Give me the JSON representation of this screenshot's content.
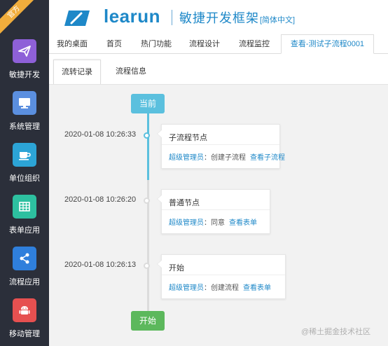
{
  "sidebar": {
    "ribbon": "官方",
    "items": [
      {
        "label": "敏捷开发",
        "icon": "paper-plane-icon",
        "color": "#8e60d8"
      },
      {
        "label": "系统管理",
        "icon": "monitor-icon",
        "color": "#5b8fdf"
      },
      {
        "label": "单位组织",
        "icon": "coffee-cup-icon",
        "color": "#2ca4d6"
      },
      {
        "label": "表单应用",
        "icon": "table-grid-icon",
        "color": "#2dc0a0"
      },
      {
        "label": "流程应用",
        "icon": "share-icon",
        "color": "#2f7fdc"
      },
      {
        "label": "移动管理",
        "icon": "android-icon",
        "color": "#e65050"
      }
    ]
  },
  "header": {
    "logo_text": "learun",
    "subtitle": "敏捷开发框架",
    "lang": "[简体中文]"
  },
  "top_tabs": [
    {
      "label": "我的桌面"
    },
    {
      "label": "首页"
    },
    {
      "label": "热门功能"
    },
    {
      "label": "流程设计"
    },
    {
      "label": "流程监控"
    },
    {
      "label": "查看-测试子流程0001",
      "active": true
    }
  ],
  "sub_tabs": [
    {
      "label": "流转记录",
      "active": true
    },
    {
      "label": "流程信息"
    }
  ],
  "timeline": {
    "top_badge": "当前",
    "bottom_badge": "开始",
    "colors": {
      "current": "#5bc0de",
      "start": "#5cb85c",
      "link": "#1e88c8"
    },
    "entries": [
      {
        "time": "2020-01-08 10:26:33",
        "title": "子流程节点",
        "user": "超级管理员",
        "action": "创建子流程",
        "link": "查看子流程"
      },
      {
        "time": "2020-01-08 10:26:20",
        "title": "普通节点",
        "user": "超级管理员",
        "action": "同意",
        "link": "查看表单"
      },
      {
        "time": "2020-01-08 10:26:13",
        "title": "开始",
        "user": "超级管理员",
        "action": "创建流程",
        "link": "查看表单"
      }
    ]
  },
  "watermark": "@稀土掘金技术社区"
}
